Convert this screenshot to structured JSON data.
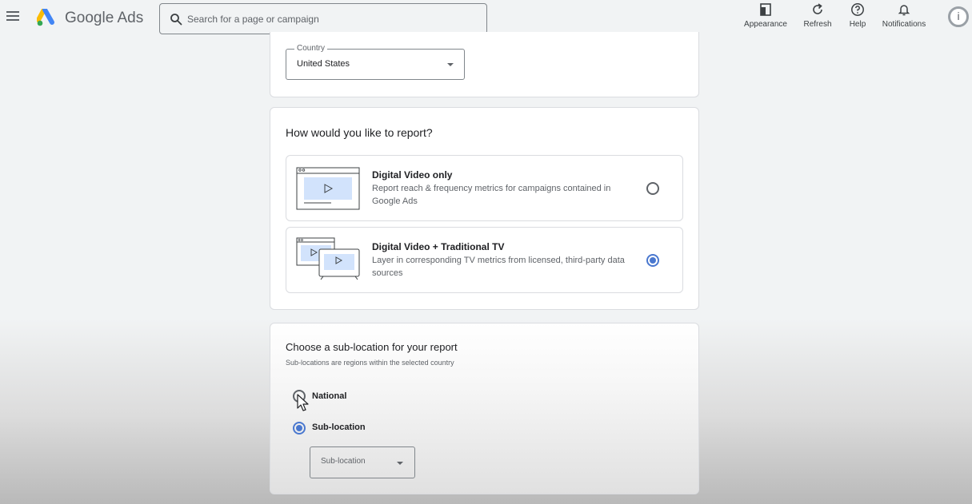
{
  "app": {
    "name": "Google Ads",
    "search_placeholder": "Search for a page or campaign"
  },
  "toolbar": {
    "appearance_label": "Appearance",
    "refresh_label": "Refresh",
    "help_label": "Help",
    "notifications_label": "Notifications"
  },
  "avatar": {
    "letter": "i"
  },
  "country": {
    "label": "Country",
    "value": "United States"
  },
  "report": {
    "title": "How would you like to report?",
    "options": [
      {
        "title": "Digital Video only",
        "description": "Report reach & frequency metrics for campaigns contained in Google Ads",
        "selected": false
      },
      {
        "title": "Digital Video + Traditional TV",
        "description": "Layer in corresponding TV metrics from licensed, third-party data sources",
        "selected": true
      }
    ]
  },
  "sublocation": {
    "title": "Choose a sub-location for your report",
    "description": "Sub-locations are regions within the selected country",
    "options": [
      {
        "label": "National",
        "selected": false
      },
      {
        "label": "Sub-location",
        "selected": true
      }
    ],
    "select_placeholder": "Sub-location"
  },
  "colors": {
    "accent": "#4a78cf",
    "background": "#f1f3f4",
    "illustration_fill": "#d2e3fc"
  }
}
